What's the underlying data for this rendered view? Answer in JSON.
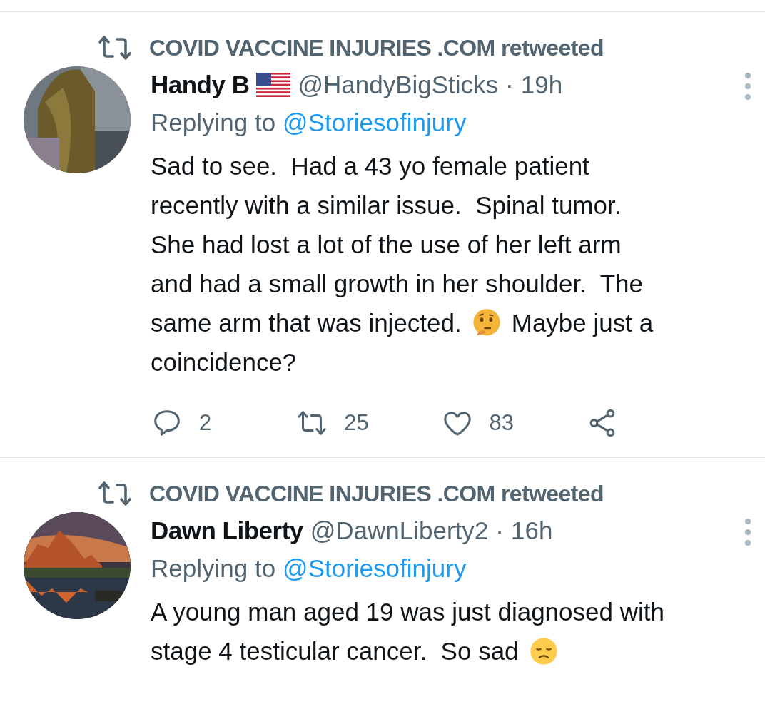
{
  "tweets": [
    {
      "retweeted_by": "COVID VACCINE INJURIES .COM",
      "retweeted_suffix": "retweeted",
      "avatar": {
        "kind": "picture"
      },
      "name": "Handy B",
      "name_emoji": {
        "kind": "flag"
      },
      "handle": "@HandyBigSticks",
      "dot": "·",
      "time": "19h",
      "replying_label": "Replying to",
      "replying_to": "@Storiesofinjury",
      "body": [
        [
          {
            "kind": "text",
            "text": "Sad to see.  Had a 43 yo female patient"
          }
        ],
        [
          {
            "kind": "text",
            "text": "recently with a similar issue.  Spinal tumor."
          }
        ],
        [
          {
            "kind": "text",
            "text": "She had lost a lot of the use of her left arm"
          }
        ],
        [
          {
            "kind": "text",
            "text": "and had a small growth in her shoulder.  The"
          }
        ],
        [
          {
            "kind": "text",
            "text": "same arm that was injected."
          },
          {
            "kind": "thinking"
          },
          {
            "kind": "text",
            "text": "Maybe just a"
          }
        ],
        [
          {
            "kind": "text",
            "text": "coincidence?"
          }
        ]
      ],
      "actions": [
        {
          "kind": "reply",
          "count": "2"
        },
        {
          "kind": "retweet",
          "count": "25"
        },
        {
          "kind": "like",
          "count": "83"
        },
        {
          "kind": "share"
        }
      ]
    },
    {
      "retweeted_by": "COVID VACCINE INJURIES .COM",
      "retweeted_suffix": "retweeted",
      "avatar": {
        "kind": "picture"
      },
      "name": "Dawn Liberty",
      "handle": "@DawnLiberty2",
      "dot": "·",
      "time": "16h",
      "replying_label": "Replying to",
      "replying_to": "@Storiesofinjury",
      "body": [
        [
          {
            "kind": "text",
            "text": "A young man aged 19 was just diagnosed with"
          }
        ],
        [
          {
            "kind": "text",
            "text": "stage 4 testicular cancer.  So sad"
          },
          {
            "kind": "sad"
          }
        ]
      ]
    }
  ]
}
